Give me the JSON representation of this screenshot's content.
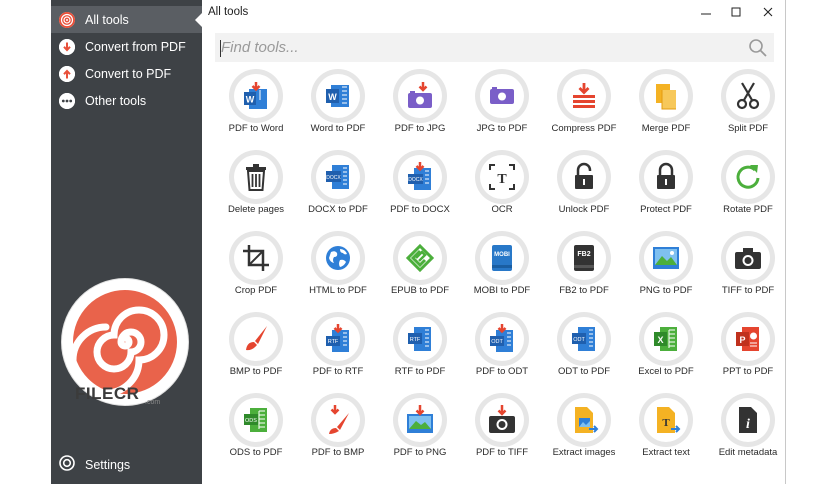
{
  "sidebar": {
    "items": [
      {
        "label": "All tools",
        "icon": "all-tools-icon",
        "active": true
      },
      {
        "label": "Convert from PDF",
        "icon": "arrow-down-circle-icon",
        "active": false
      },
      {
        "label": "Convert to PDF",
        "icon": "arrow-up-circle-icon",
        "active": false
      },
      {
        "label": "Other tools",
        "icon": "more-dots-icon",
        "active": false
      }
    ],
    "settings_label": "Settings"
  },
  "watermark": {
    "text": "FILECR",
    "domain": ".com"
  },
  "window": {
    "title": "All tools"
  },
  "search": {
    "placeholder": "Find tools..."
  },
  "tools": [
    {
      "label": "PDF to Word",
      "icon": "pdf-to-word-icon"
    },
    {
      "label": "Word to PDF",
      "icon": "word-to-pdf-icon"
    },
    {
      "label": "PDF to JPG",
      "icon": "pdf-to-jpg-icon"
    },
    {
      "label": "JPG to PDF",
      "icon": "jpg-to-pdf-icon"
    },
    {
      "label": "Compress PDF",
      "icon": "compress-icon"
    },
    {
      "label": "Merge PDF",
      "icon": "merge-icon"
    },
    {
      "label": "Split PDF",
      "icon": "scissors-icon"
    },
    {
      "label": "Delete pages",
      "icon": "trash-icon"
    },
    {
      "label": "DOCX to PDF",
      "icon": "docx-to-pdf-icon"
    },
    {
      "label": "PDF to DOCX",
      "icon": "pdf-to-docx-icon"
    },
    {
      "label": "OCR",
      "icon": "ocr-icon"
    },
    {
      "label": "Unlock PDF",
      "icon": "unlock-icon"
    },
    {
      "label": "Protect PDF",
      "icon": "lock-icon"
    },
    {
      "label": "Rotate PDF",
      "icon": "rotate-icon"
    },
    {
      "label": "Crop PDF",
      "icon": "crop-icon"
    },
    {
      "label": "HTML to PDF",
      "icon": "globe-icon"
    },
    {
      "label": "EPUB to PDF",
      "icon": "epub-icon"
    },
    {
      "label": "MOBI to PDF",
      "icon": "mobi-icon"
    },
    {
      "label": "FB2 to PDF",
      "icon": "fb2-icon"
    },
    {
      "label": "PNG to PDF",
      "icon": "png-image-icon"
    },
    {
      "label": "TIFF to PDF",
      "icon": "camera-icon"
    },
    {
      "label": "BMP to PDF",
      "icon": "paintbrush-icon"
    },
    {
      "label": "PDF to RTF",
      "icon": "pdf-to-rtf-icon"
    },
    {
      "label": "RTF to PDF",
      "icon": "rtf-to-pdf-icon"
    },
    {
      "label": "PDF to ODT",
      "icon": "pdf-to-odt-icon"
    },
    {
      "label": "ODT to PDF",
      "icon": "odt-to-pdf-icon"
    },
    {
      "label": "Excel to PDF",
      "icon": "excel-icon"
    },
    {
      "label": "PPT to PDF",
      "icon": "powerpoint-icon"
    },
    {
      "label": "ODS to PDF",
      "icon": "ods-icon"
    },
    {
      "label": "PDF to BMP",
      "icon": "pdf-to-bmp-icon"
    },
    {
      "label": "PDF to PNG",
      "icon": "pdf-to-png-icon"
    },
    {
      "label": "PDF to TIFF",
      "icon": "pdf-to-tiff-icon"
    },
    {
      "label": "Extract images",
      "icon": "extract-images-icon"
    },
    {
      "label": "Extract text",
      "icon": "extract-text-icon"
    },
    {
      "label": "Edit metadata",
      "icon": "info-doc-icon"
    }
  ],
  "icon_glyphs": {
    "docx": "DOCX",
    "rtf": "RTF",
    "odt": "ODT",
    "mobi": "MOBI",
    "fb2": "FB2",
    "ods": "ODS",
    "w": "W",
    "x": "X",
    "p": "P",
    "t": "T",
    "i": "i"
  },
  "colors": {
    "sidebar_bg": "#3e4246",
    "sidebar_active": "#5a5e63",
    "accent_red": "#e8503a",
    "word_blue": "#2f7fd7",
    "pdf_red": "#e5452f",
    "purple": "#7a5ec8",
    "green": "#4caf3c",
    "yellow": "#f4b223",
    "dark": "#333333"
  }
}
